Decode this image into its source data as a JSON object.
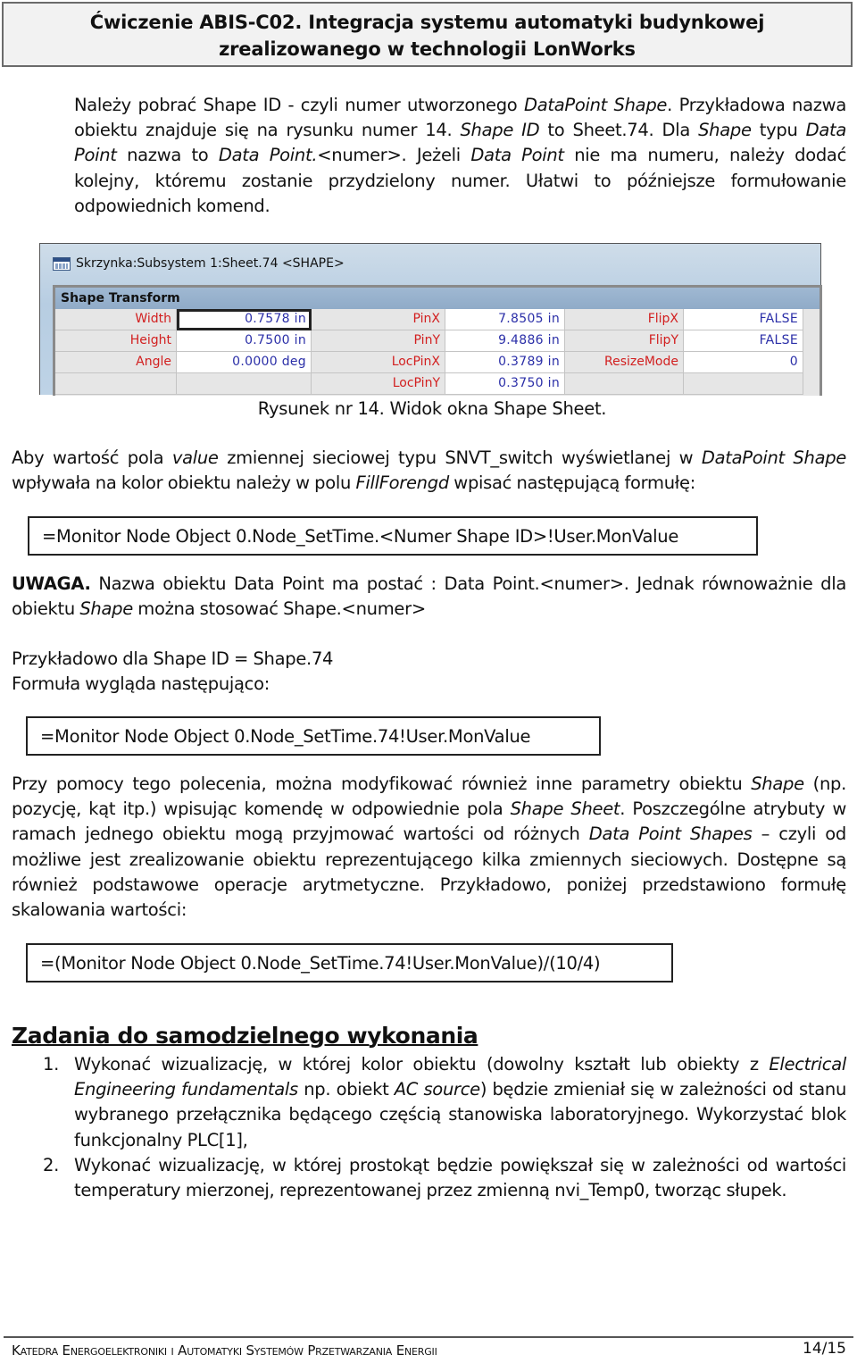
{
  "header": {
    "title_line1": "Ćwiczenie ABIS-C02. Integracja systemu automatyki budynkowej",
    "title_line2": "zrealizowanego w technologii LonWorks"
  },
  "intro": {
    "parts": [
      {
        "t": "Należy pobrać Shape ID - czyli numer utworzonego ",
        "i": false
      },
      {
        "t": "DataPoint Shape",
        "i": true
      },
      {
        "t": ". Przykładowa nazwa obiektu znajduje się na rysunku numer 14. ",
        "i": false
      },
      {
        "t": "Shape ID",
        "i": true
      },
      {
        "t": " to Sheet.74. Dla ",
        "i": false
      },
      {
        "t": "Shape",
        "i": true
      },
      {
        "t": " typu ",
        "i": false
      },
      {
        "t": "Data Point",
        "i": true
      },
      {
        "t": " nazwa to ",
        "i": false
      },
      {
        "t": "Data Point.",
        "i": true
      },
      {
        "t": "<numer>. Jeżeli ",
        "i": false
      },
      {
        "t": "Data Point",
        "i": true
      },
      {
        "t": " nie ma numeru, należy dodać kolejny, któremu zostanie przydzielony numer. Ułatwi to późniejsze formułowanie odpowiednich komend.",
        "i": false
      }
    ]
  },
  "shape_sheet": {
    "window_title": "Skrzynka:Subsystem 1:Sheet.74 <SHAPE>",
    "section_title": "Shape Transform",
    "rows": [
      [
        {
          "label": "Width",
          "value": "0.7578 in"
        },
        {
          "label": "PinX",
          "value": "7.8505 in"
        },
        {
          "label": "FlipX",
          "value": "FALSE"
        }
      ],
      [
        {
          "label": "Height",
          "value": "0.7500 in"
        },
        {
          "label": "PinY",
          "value": "9.4886 in"
        },
        {
          "label": "FlipY",
          "value": "FALSE"
        }
      ],
      [
        {
          "label": "Angle",
          "value": "0.0000 deg"
        },
        {
          "label": "LocPinX",
          "value": "0.3789 in"
        },
        {
          "label": "ResizeMode",
          "value": "0"
        }
      ],
      [
        {
          "label": "",
          "value": ""
        },
        {
          "label": "LocPinY",
          "value": "0.3750 in"
        },
        {
          "label": "",
          "value": ""
        }
      ]
    ],
    "caption": "Rysunek nr 14. Widok okna Shape Sheet."
  },
  "para2": {
    "parts": [
      {
        "t": "Aby wartość pola ",
        "i": false
      },
      {
        "t": "value",
        "i": true
      },
      {
        "t": " zmiennej sieciowej typu SNVT_switch wyświetlanej w ",
        "i": false
      },
      {
        "t": "DataPoint Shape",
        "i": true
      },
      {
        "t": " wpływała na kolor obiektu należy w polu ",
        "i": false
      },
      {
        "t": "FillForengd",
        "i": true
      },
      {
        "t": " wpisać następującą formułę:",
        "i": false
      }
    ]
  },
  "formula1": "=Monitor Node Object 0.Node_SetTime.<Numer Shape ID>!User.MonValue",
  "note": {
    "bold": "UWAGA.",
    "parts": [
      {
        "t": " Nazwa obiektu Data Point ma postać : Data Point.<numer>. Jednak równoważnie dla obiektu ",
        "i": false
      },
      {
        "t": "Shape",
        "i": true
      },
      {
        "t": " można stosować Shape.<numer>",
        "i": false
      }
    ]
  },
  "example": {
    "line1": "Przykładowo dla Shape ID = Shape.74",
    "line2": "Formuła wygląda następująco:"
  },
  "formula2": "=Monitor Node Object 0.Node_SetTime.74!User.MonValue",
  "para3": {
    "parts": [
      {
        "t": "Przy pomocy tego polecenia, można modyfikować również inne parametry obiektu ",
        "i": false
      },
      {
        "t": "Shape",
        "i": true
      },
      {
        "t": " (np. pozycję, kąt itp.) wpisując komendę w odpowiednie pola ",
        "i": false
      },
      {
        "t": "Shape Sheet",
        "i": true
      },
      {
        "t": ". Poszczególne atrybuty w ramach jednego obiektu mogą przyjmować wartości od różnych ",
        "i": false
      },
      {
        "t": "Data Point Shapes",
        "i": true
      },
      {
        "t": " – czyli od możliwe jest zrealizowanie obiektu reprezentującego kilka zmiennych sieciowych. Dostępne są również podstawowe operacje arytmetyczne. Przykładowo, poniżej przedstawiono formułę skalowania wartości:",
        "i": false
      }
    ]
  },
  "formula3": "=(Monitor Node Object 0.Node_SetTime.74!User.MonValue)/(10/4)",
  "tasks": {
    "heading": "Zadania do samodzielnego wykonania",
    "items": [
      {
        "num": "1.",
        "parts": [
          {
            "t": "Wykonać wizualizację, w której kolor obiektu (dowolny kształt lub obiekty z ",
            "i": false
          },
          {
            "t": "Electrical Engineering fundamentals",
            "i": true
          },
          {
            "t": " np. obiekt ",
            "i": false
          },
          {
            "t": "AC source",
            "i": true
          },
          {
            "t": ") będzie zmieniał się w zależności od stanu wybranego przełącznika będącego częścią stanowiska laboratoryjnego. Wykorzystać blok funkcjonalny PLC[1],",
            "i": false
          }
        ]
      },
      {
        "num": "2.",
        "parts": [
          {
            "t": "Wykonać wizualizację, w której prostokąt będzie powiększał się w zależności od wartości temperatury mierzonej, reprezentowanej przez zmienną nvi_Temp0, tworząc słupek.",
            "i": false
          }
        ]
      }
    ]
  },
  "footer": {
    "department": "Katedra Energoelektroniki i Automatyki Systemów Przetwarzania Energii",
    "page": "14/15"
  }
}
